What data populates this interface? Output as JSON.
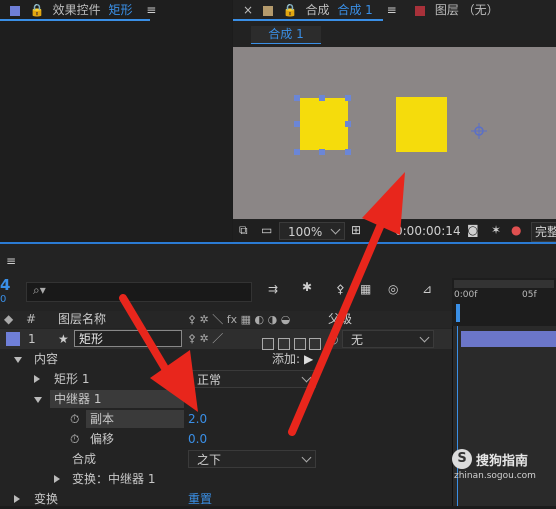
{
  "effect_panel": {
    "title": "效果控件",
    "target": "矩形"
  },
  "comp_panel": {
    "title": "合成",
    "comp_name": "合成 1",
    "tab_label": "合成 1"
  },
  "layer_panel": {
    "title": "图层 （无）"
  },
  "viewer_toolbar": {
    "zoom": "100%",
    "timecode": "0:00:00:14",
    "quality": "完整"
  },
  "timeline": {
    "frame_digit": "4",
    "search_placeholder": "",
    "ruler": {
      "start": "0:00f",
      "mark": "05f"
    },
    "columns": {
      "num": "#",
      "layer_name": "图层名称",
      "parent": "父级"
    },
    "layer": {
      "index": "1",
      "name": "矩形",
      "parent_value": "无"
    },
    "rows": {
      "content": "内容",
      "add_label": "添加:",
      "rect": "矩形 1",
      "repeater": "中继器 1",
      "copies_label": "副本",
      "copies_value": "2.0",
      "offset_label": "偏移",
      "offset_value": "0.0",
      "composite_label": "合成",
      "composite_value": "之下",
      "transform_label": "变换：中继器 1",
      "transform2_label": "变换",
      "reset_label": "重置",
      "rect_mode": "正常"
    }
  },
  "watermark": {
    "brand": "搜狗指南",
    "url": "zhinan.sogou.com"
  },
  "colors": {
    "accent": "#3a8fe6",
    "yellow": "#f5dc0c",
    "canvas": "#8b8686",
    "arrow": "#e8261c"
  }
}
